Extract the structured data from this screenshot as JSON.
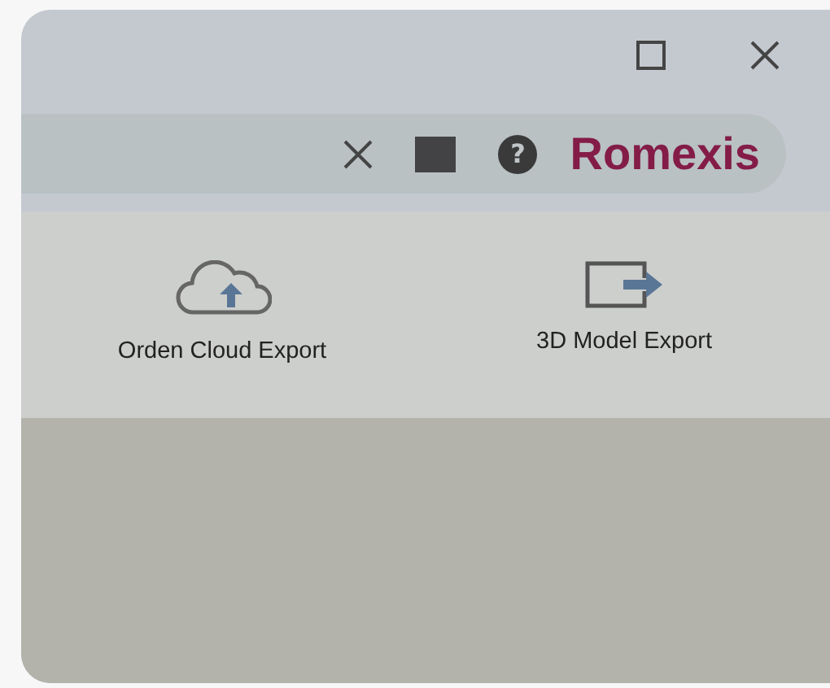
{
  "window_controls": [
    {
      "kind": "maximize"
    },
    {
      "kind": "close"
    }
  ],
  "toolbar": {
    "tools": [
      {
        "kind": "close"
      },
      {
        "kind": "stop"
      },
      {
        "kind": "help",
        "glyph": "?"
      }
    ],
    "brand": "Romexis"
  },
  "exports": [
    {
      "kind": "cloud",
      "label": "Orden Cloud Export"
    },
    {
      "kind": "export",
      "label": "3D Model Export"
    }
  ]
}
